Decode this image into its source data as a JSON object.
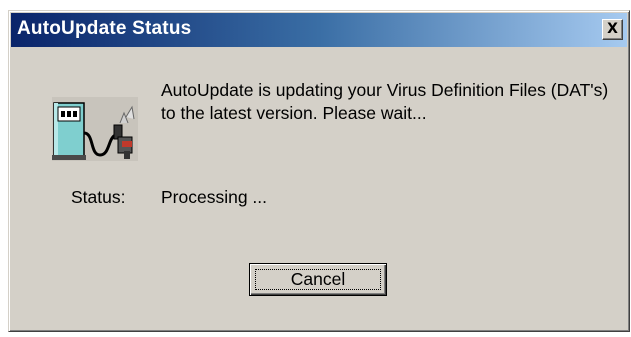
{
  "window": {
    "title": "AutoUpdate Status",
    "close_glyph": "X"
  },
  "icon": {
    "name": "fuel-pump-icon"
  },
  "message": "AutoUpdate is updating your Virus Definition Files (DAT's) to the latest version.  Please wait...",
  "status": {
    "label": "Status:",
    "value": "Processing ..."
  },
  "buttons": {
    "cancel_label": "Cancel"
  },
  "colors": {
    "title_start": "#0a246a",
    "title_end": "#a6caf0",
    "face": "#d4d0c8",
    "pump_body": "#7fcfcf"
  }
}
